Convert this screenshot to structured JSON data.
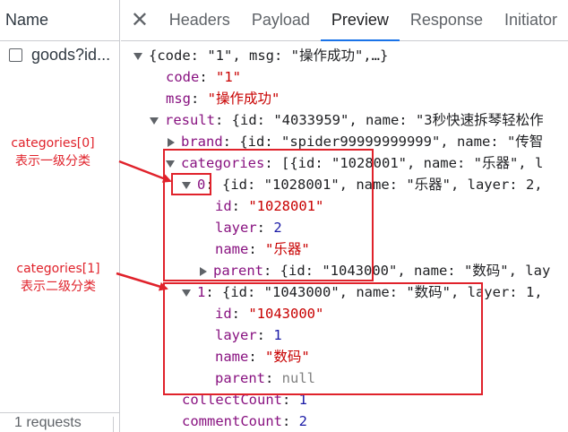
{
  "left_panel": {
    "header": "Name",
    "request_name": "goods?id...",
    "footer": "1 requests"
  },
  "tabs": {
    "close_icon": "close-icon",
    "items": [
      "Headers",
      "Payload",
      "Preview",
      "Response",
      "Initiator"
    ],
    "active": "Preview"
  },
  "tree": {
    "root_summary": "{code: \"1\", msg: \"操作成功\",…}",
    "code_key": "code",
    "code_value": "\"1\"",
    "msg_key": "msg",
    "msg_value": "\"操作成功\"",
    "result_key": "result",
    "result_summary": "{id: \"4033959\", name: \"3秒快速拆琴轻松作",
    "brand_key": "brand",
    "brand_summary": "{id: \"spider99999999999\", name: \"传智",
    "categories_key": "categories",
    "categories_summary": "[{id: \"1028001\", name: \"乐器\", l",
    "cat0_key": "0",
    "cat0_summary": "{id: \"1028001\", name: \"乐器\", layer: 2,",
    "cat0_id_key": "id",
    "cat0_id_value": "\"1028001\"",
    "cat0_layer_key": "layer",
    "cat0_layer_value": "2",
    "cat0_name_key": "name",
    "cat0_name_value": "\"乐器\"",
    "cat0_parent_key": "parent",
    "cat0_parent_summary": "{id: \"1043000\", name: \"数码\", lay",
    "cat1_key": "1",
    "cat1_summary": "{id: \"1043000\", name: \"数码\", layer: 1,",
    "cat1_id_key": "id",
    "cat1_id_value": "\"1043000\"",
    "cat1_layer_key": "layer",
    "cat1_layer_value": "1",
    "cat1_name_key": "name",
    "cat1_name_value": "\"数码\"",
    "cat1_parent_key": "parent",
    "cat1_parent_value": "null",
    "collect_key": "collectCount",
    "collect_value": "1",
    "comment_key": "commentCount",
    "comment_value": "2"
  },
  "annotations": {
    "note0_line1": "categories[0]",
    "note0_line2": "表示一级分类",
    "note1_line1": "categories[1]",
    "note1_line2": "表示二级分类",
    "color": "#e0222b"
  },
  "colors": {
    "key": "#881280",
    "string": "#c80000",
    "number": "#1a1aa6",
    "null": "#808080",
    "tab_underline": "#1a73e8"
  }
}
